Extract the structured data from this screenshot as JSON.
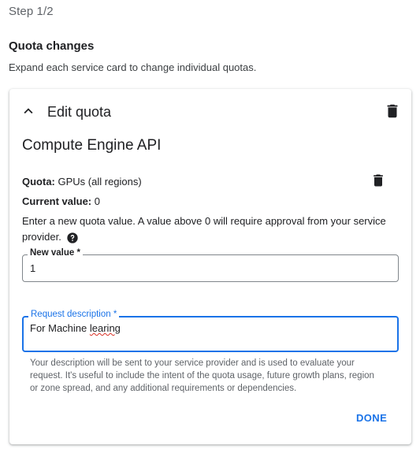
{
  "step_label": "Step 1/2",
  "section": {
    "title": "Quota changes",
    "description": "Expand each service card to change individual quotas."
  },
  "card": {
    "header_title": "Edit quota",
    "service_name": "Compute Engine API",
    "quota_label": "Quota:",
    "quota_value": "GPUs (all regions)",
    "current_label": "Current value:",
    "current_value": "0",
    "instruction": "Enter a new quota value. A value above 0 will require approval from your service provider.",
    "new_value_field": {
      "label": "New value *",
      "value": "1"
    },
    "request_description_field": {
      "label": "Request description *",
      "value_prefix": "For Machine ",
      "value_misspelled": "learing"
    },
    "helper_text": "Your description will be sent to your service provider and is used to evaluate your request. It's useful to include the intent of the quota usage, future growth plans, region or zone spread, and any additional requirements or dependencies.",
    "done_label": "DONE"
  },
  "colors": {
    "accent": "#1a73e8",
    "text": "#202124",
    "muted": "#5f6368",
    "spell_error": "#d93025"
  },
  "icons": [
    "chevron-up-icon",
    "trash-icon",
    "help-icon"
  ]
}
